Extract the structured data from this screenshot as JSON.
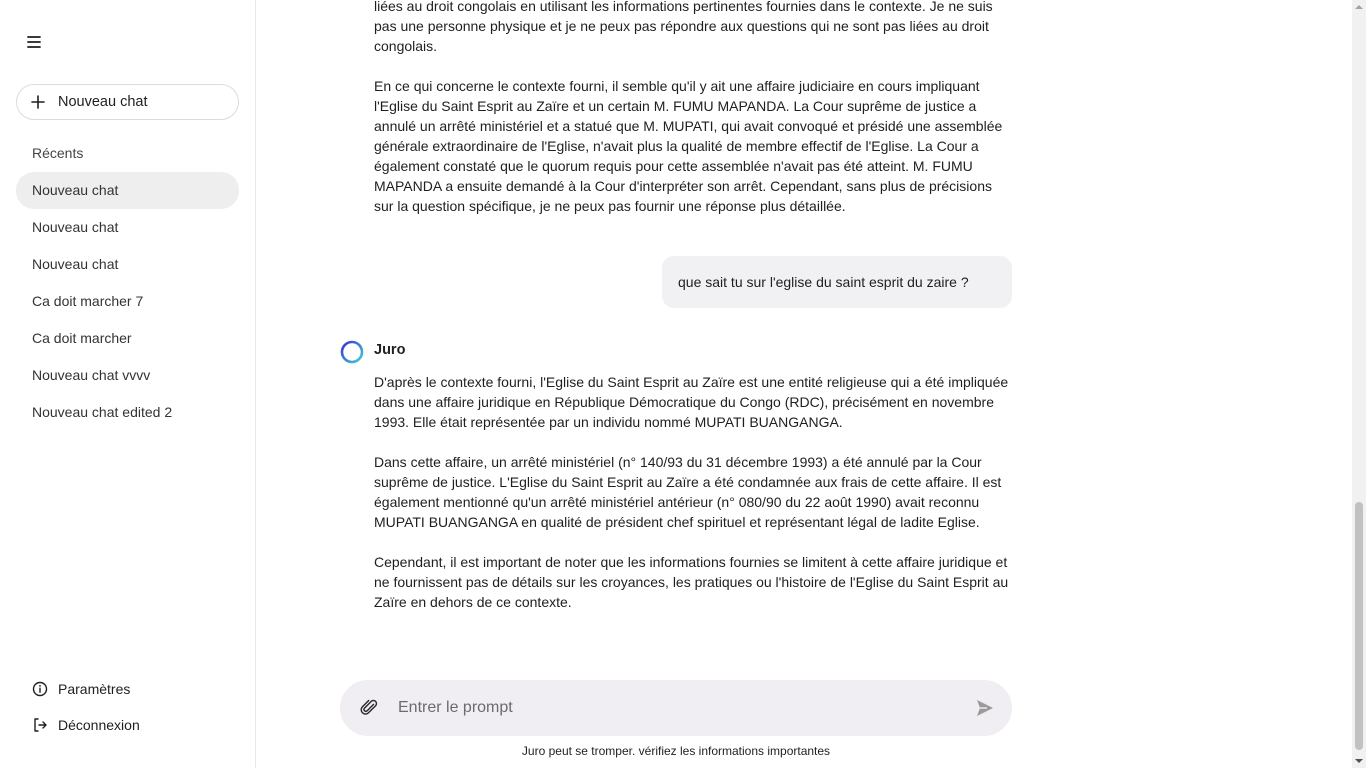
{
  "sidebar": {
    "new_chat_label": "Nouveau chat",
    "recents_title": "Récents",
    "items": [
      {
        "label": "Nouveau chat",
        "active": true
      },
      {
        "label": "Nouveau chat",
        "active": false
      },
      {
        "label": "Nouveau chat",
        "active": false
      },
      {
        "label": "Ca doit marcher 7",
        "active": false
      },
      {
        "label": "Ca doit marcher",
        "active": false
      },
      {
        "label": "Nouveau chat vvvv",
        "active": false
      },
      {
        "label": "Nouveau chat edited 2",
        "active": false
      }
    ],
    "settings_label": "Paramètres",
    "logout_label": "Déconnexion"
  },
  "conversation": {
    "prev_answer": {
      "p1": "liées au droit congolais en utilisant les informations pertinentes fournies dans le contexte. Je ne suis pas une personne physique et je ne peux pas répondre aux questions qui ne sont pas liées au droit congolais.",
      "p2": "En ce qui concerne le contexte fourni, il semble qu'il y ait une affaire judiciaire en cours impliquant l'Eglise du Saint Esprit au Zaïre et un certain M. FUMU MAPANDA. La Cour suprême de justice a annulé un arrêté ministériel et a statué que M. MUPATI, qui avait convoqué et présidé une assemblée générale extraordinaire de l'Eglise, n'avait plus la qualité de membre effectif de l'Eglise. La Cour a également constaté que le quorum requis pour cette assemblée n'avait pas été atteint. M. FUMU MAPANDA a ensuite demandé à la Cour d'interpréter son arrêt. Cependant, sans plus de précisions sur la question spécifique, je ne peux pas fournir une réponse plus détaillée."
    },
    "user_message": "que sait tu sur l'eglise du saint esprit du zaire ?",
    "assistant_name": "Juro",
    "answer": {
      "p1": "D'après le contexte fourni, l'Eglise du Saint Esprit au Zaïre est une entité religieuse qui a été impliquée dans une affaire juridique en République Démocratique du Congo (RDC), précisément en novembre 1993. Elle était représentée par un individu nommé MUPATI BUANGANGA.",
      "p2": "Dans cette affaire, un arrêté ministériel (n° 140/93 du 31 décembre 1993) a été annulé par la Cour suprême de justice. L'Eglise du Saint Esprit au Zaïre a été condamnée aux frais de cette affaire. Il est également mentionné qu'un arrêté ministériel antérieur (n° 080/90 du 22 août 1990) avait reconnu MUPATI BUANGANGA en qualité de président chef spirituel et représentant légal de ladite Eglise.",
      "p3": "Cependant, il est important de noter que les informations fournies se limitent à cette affaire juridique et ne fournissent pas de détails sur les croyances, les pratiques ou l'histoire de l'Eglise du Saint Esprit au Zaïre en dehors de ce contexte."
    }
  },
  "prompt": {
    "placeholder": "Entrer le prompt",
    "value": ""
  },
  "disclaimer": "Juro peut se tromper. vérifiez les informations importantes",
  "colors": {
    "active_item_bg": "#eeeeef",
    "prompt_bg": "#f0eef3",
    "avatar_ring_start": "#3b3bd6",
    "avatar_ring_end": "#3fd0d8"
  }
}
